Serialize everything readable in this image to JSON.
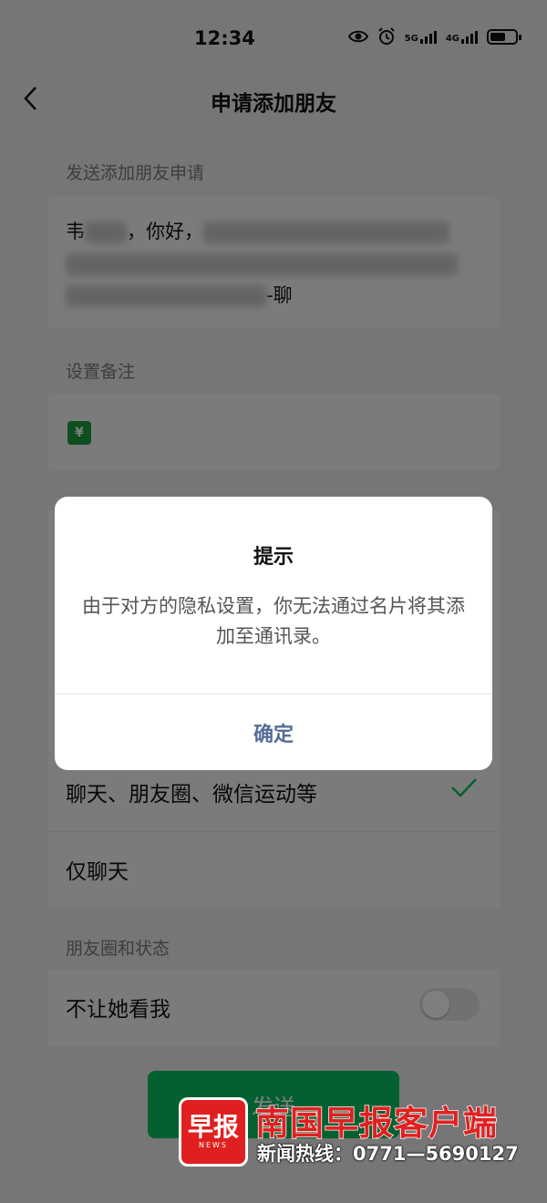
{
  "status_bar": {
    "time": "12:34",
    "net1": "5G",
    "net2": "4G",
    "battery_level": 0.6
  },
  "nav": {
    "title": "申请添加朋友"
  },
  "request_section": {
    "label": "发送添加朋友申请",
    "message_prefix": "韦",
    "message_greeting": "，你好，",
    "message_suffix": "-聊"
  },
  "remark_section": {
    "label": "设置备注"
  },
  "permissions": {
    "option_all": "聊天、朋友圈、微信运动等",
    "option_chat_only": "仅聊天"
  },
  "moments_section": {
    "label": "朋友圈和状态",
    "hide_from_label": "不让她看我",
    "hide_from_on": false
  },
  "send_button": {
    "label": "发送"
  },
  "dialog": {
    "title": "提示",
    "message": "由于对方的隐私设置，你无法通过名片将其添加至通讯录。",
    "ok_label": "确定"
  },
  "watermark": {
    "logo_text": "早报",
    "logo_sub": "NEWS",
    "title": "南国早报客户端",
    "hotline": "新闻热线：0771—5690127"
  },
  "colors": {
    "accent_green": "#07c160",
    "dialog_link": "#576b95",
    "brand_red": "#e02020"
  }
}
